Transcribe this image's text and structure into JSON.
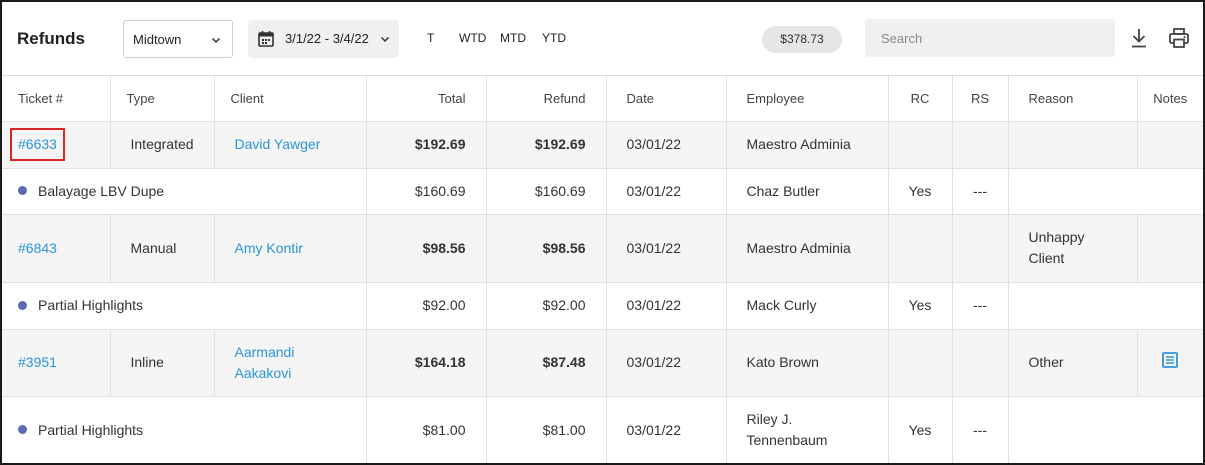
{
  "header": {
    "title": "Refunds",
    "location": "Midtown",
    "date_range": "3/1/22 - 3/4/22",
    "quick_filters": [
      "T",
      "WTD",
      "MTD",
      "YTD"
    ],
    "total_badge": "$378.73",
    "search_placeholder": "Search"
  },
  "table": {
    "columns": [
      "Ticket #",
      "Type",
      "Client",
      "Total",
      "Refund",
      "Date",
      "Employee",
      "RC",
      "RS",
      "Reason",
      "Notes"
    ],
    "rows": [
      {
        "kind": "ticket",
        "ticket": "#6633",
        "type": "Integrated",
        "client_line1": "David Yawger",
        "client_line2": "",
        "total": "$192.69",
        "refund": "$192.69",
        "date": "03/01/22",
        "employee_line1": "Maestro Adminia",
        "employee_line2": "",
        "rc": "",
        "rs": "",
        "reason_line1": "",
        "reason_line2": "",
        "has_note": false
      },
      {
        "kind": "item",
        "service": "Balayage LBV Dupe",
        "total": "$160.69",
        "refund": "$160.69",
        "date": "03/01/22",
        "employee_line1": "Chaz Butler",
        "employee_line2": "",
        "rc": "Yes",
        "rs": "---"
      },
      {
        "kind": "ticket",
        "ticket": "#6843",
        "type": "Manual",
        "client_line1": "Amy Kontir",
        "client_line2": "",
        "total": "$98.56",
        "refund": "$98.56",
        "date": "03/01/22",
        "employee_line1": "Maestro Adminia",
        "employee_line2": "",
        "rc": "",
        "rs": "",
        "reason_line1": "Unhappy",
        "reason_line2": "Client",
        "has_note": false
      },
      {
        "kind": "item",
        "service": "Partial Highlights",
        "total": "$92.00",
        "refund": "$92.00",
        "date": "03/01/22",
        "employee_line1": "Mack Curly",
        "employee_line2": "",
        "rc": "Yes",
        "rs": "---"
      },
      {
        "kind": "ticket",
        "ticket": "#3951",
        "type": "Inline",
        "client_line1": "Aarmandi",
        "client_line2": "Aakakovi",
        "total": "$164.18",
        "refund": "$87.48",
        "date": "03/01/22",
        "employee_line1": "Kato Brown",
        "employee_line2": "",
        "rc": "",
        "rs": "",
        "reason_line1": "Other",
        "reason_line2": "",
        "has_note": true
      },
      {
        "kind": "item",
        "service": "Partial Highlights",
        "total": "$81.00",
        "refund": "$81.00",
        "date": "03/01/22",
        "employee_line1": "Riley J.",
        "employee_line2": "Tennenbaum",
        "rc": "Yes",
        "rs": "---"
      }
    ]
  },
  "colors": {
    "link": "#2b95d6",
    "highlight_border": "#d9262b",
    "dot": "#5b6ab3",
    "ticket_row_bg": "#f5f5f5",
    "note_icon": "#2b95d6"
  },
  "icons": [
    "chevron-down-icon",
    "calendar-icon",
    "download-icon",
    "print-icon",
    "note-icon"
  ]
}
